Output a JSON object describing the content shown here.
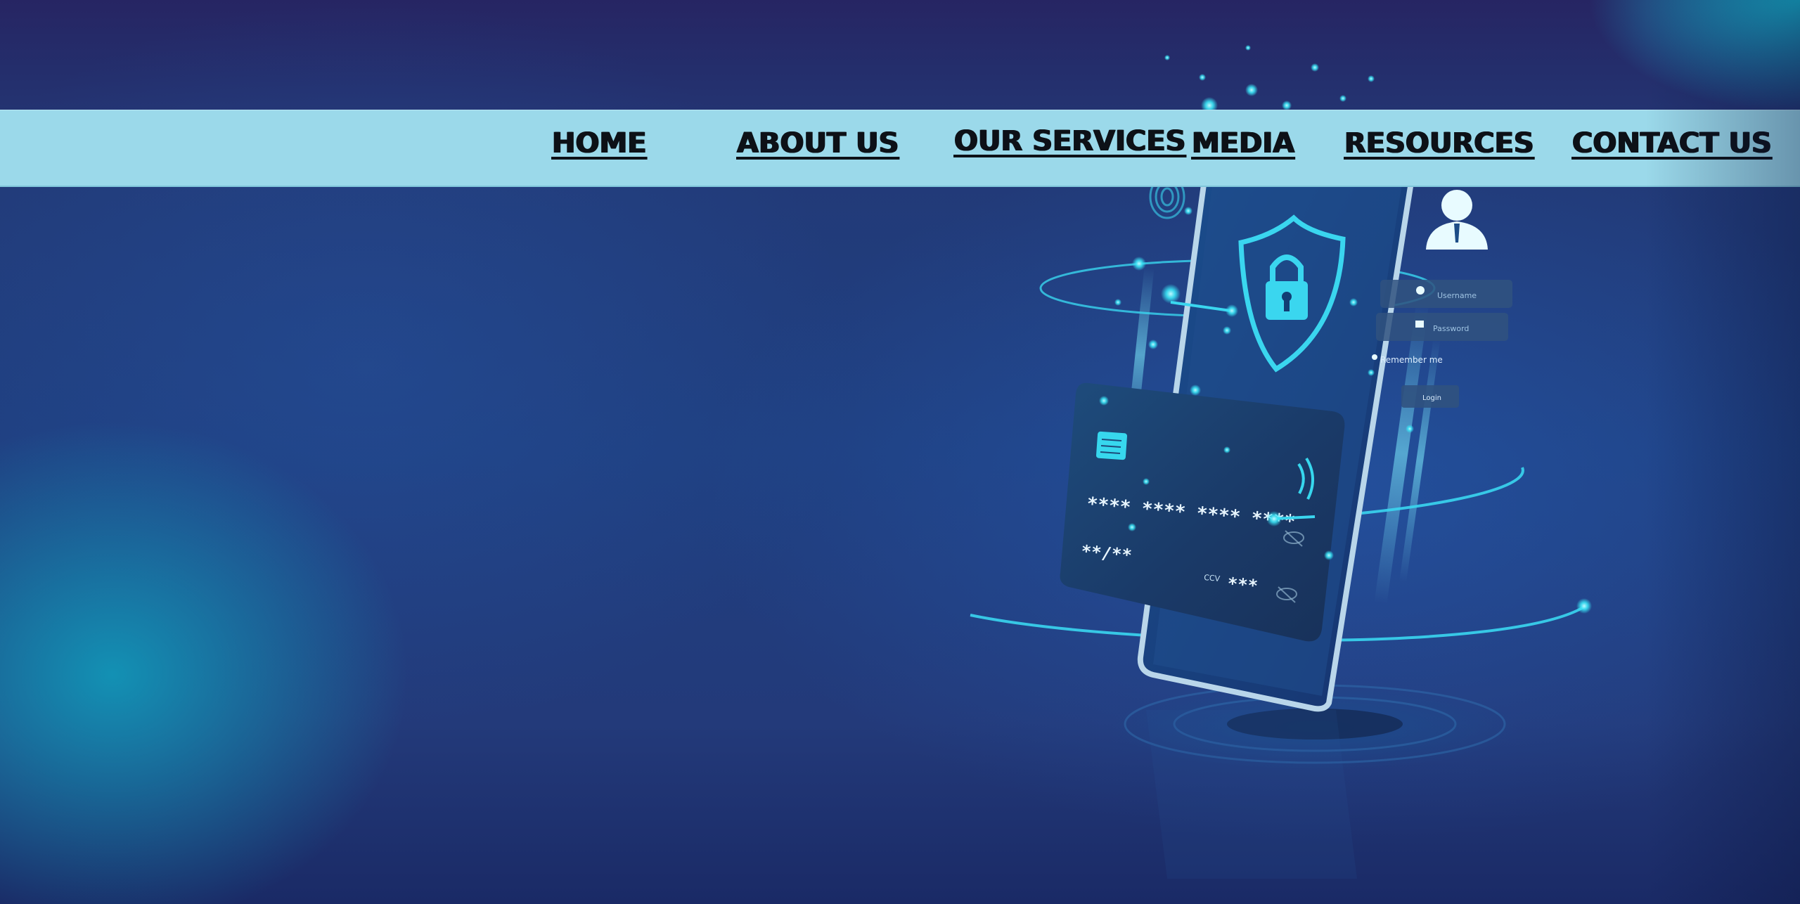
{
  "nav": {
    "items": [
      {
        "label": "HOME"
      },
      {
        "label": "ABOUT US"
      },
      {
        "label": "OUR SERVICES"
      },
      {
        "label": "MEDIA"
      },
      {
        "label": "RESOURCES"
      },
      {
        "label": "CONTACT US"
      }
    ]
  },
  "illustration": {
    "card_number": "**** **** **** ****",
    "card_expiry": "**/**",
    "card_ccv_label": "CCV",
    "card_ccv_value": "***",
    "login_username_placeholder": "Username",
    "login_password_placeholder": "Password",
    "login_remember_label": "Remember me",
    "login_button_label": "Login"
  },
  "colors": {
    "navbar_bg": "#9bd9ea",
    "nav_text": "#0d1117",
    "accent_glow": "#39e3f5",
    "background_deep": "#1f3572"
  }
}
